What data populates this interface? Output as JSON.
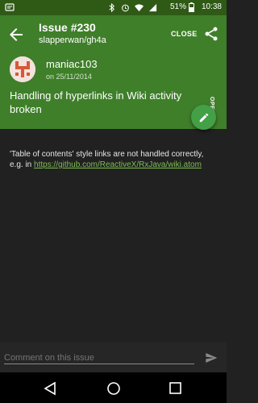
{
  "status_bar": {
    "battery": "51%",
    "time": "10:38",
    "icons": [
      "notification-icon",
      "bluetooth-icon",
      "alarm-icon",
      "wifi-icon",
      "signal-icon",
      "battery-icon"
    ]
  },
  "header": {
    "title": "Issue #230",
    "repo": "slapperwan/gh4a",
    "close_label": "CLOSE",
    "author": "maniac103",
    "date": "on 25/11/2014",
    "issue_title": "Handling of hyperlinks in Wiki activity broken",
    "state": "OPEN",
    "accent_color": "#3f7f2a"
  },
  "body": {
    "text": "'Table of contents' style links are not handled correctly, e.g. in ",
    "link": "https://github.com/ReactiveX/RxJava/wiki.atom"
  },
  "composer": {
    "placeholder": "Comment on this issue"
  }
}
